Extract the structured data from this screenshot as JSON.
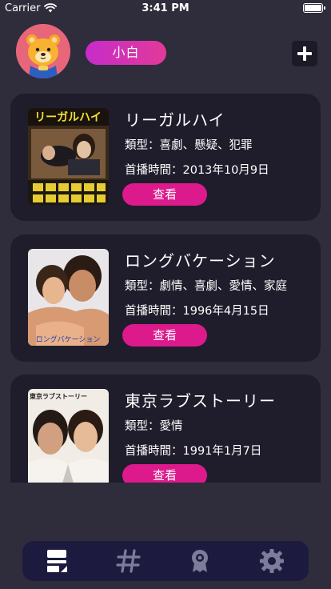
{
  "status_bar": {
    "carrier": "Carrier",
    "time": "3:41 PM",
    "icons": [
      "wifi-icon",
      "battery-icon"
    ]
  },
  "profile": {
    "avatar_icon": "bear-avatar-icon",
    "name": "小白",
    "add_icon": "plus-icon"
  },
  "dramas": [
    {
      "title": "リーガルハイ",
      "genre": "類型：喜劇、懸疑、犯罪",
      "date": "首播時間：2013年10月9日",
      "button": "查看",
      "poster_text": "リーガルハイ"
    },
    {
      "title": "ロングバケーション",
      "genre": "類型：劇情、喜劇、愛情、家庭",
      "date": "首播時間：1996年4月15日",
      "button": "查看",
      "poster_text": "ロングバケーション"
    },
    {
      "title": "東京ラブストーリー",
      "genre": "類型：愛情",
      "date": "首播時間：1991年1月7日",
      "button": "查看",
      "poster_text": "東京ラブストーリー"
    }
  ],
  "tab_bar": {
    "tabs": [
      "list-tab-icon",
      "hashtag-tab-icon",
      "award-tab-icon",
      "settings-tab-icon"
    ],
    "active_index": 0
  },
  "colors": {
    "background": "#2f2c3c",
    "card": "#1f1d2b",
    "accent": "#dc1a8c",
    "tab_bar": "#1c1b3f"
  }
}
